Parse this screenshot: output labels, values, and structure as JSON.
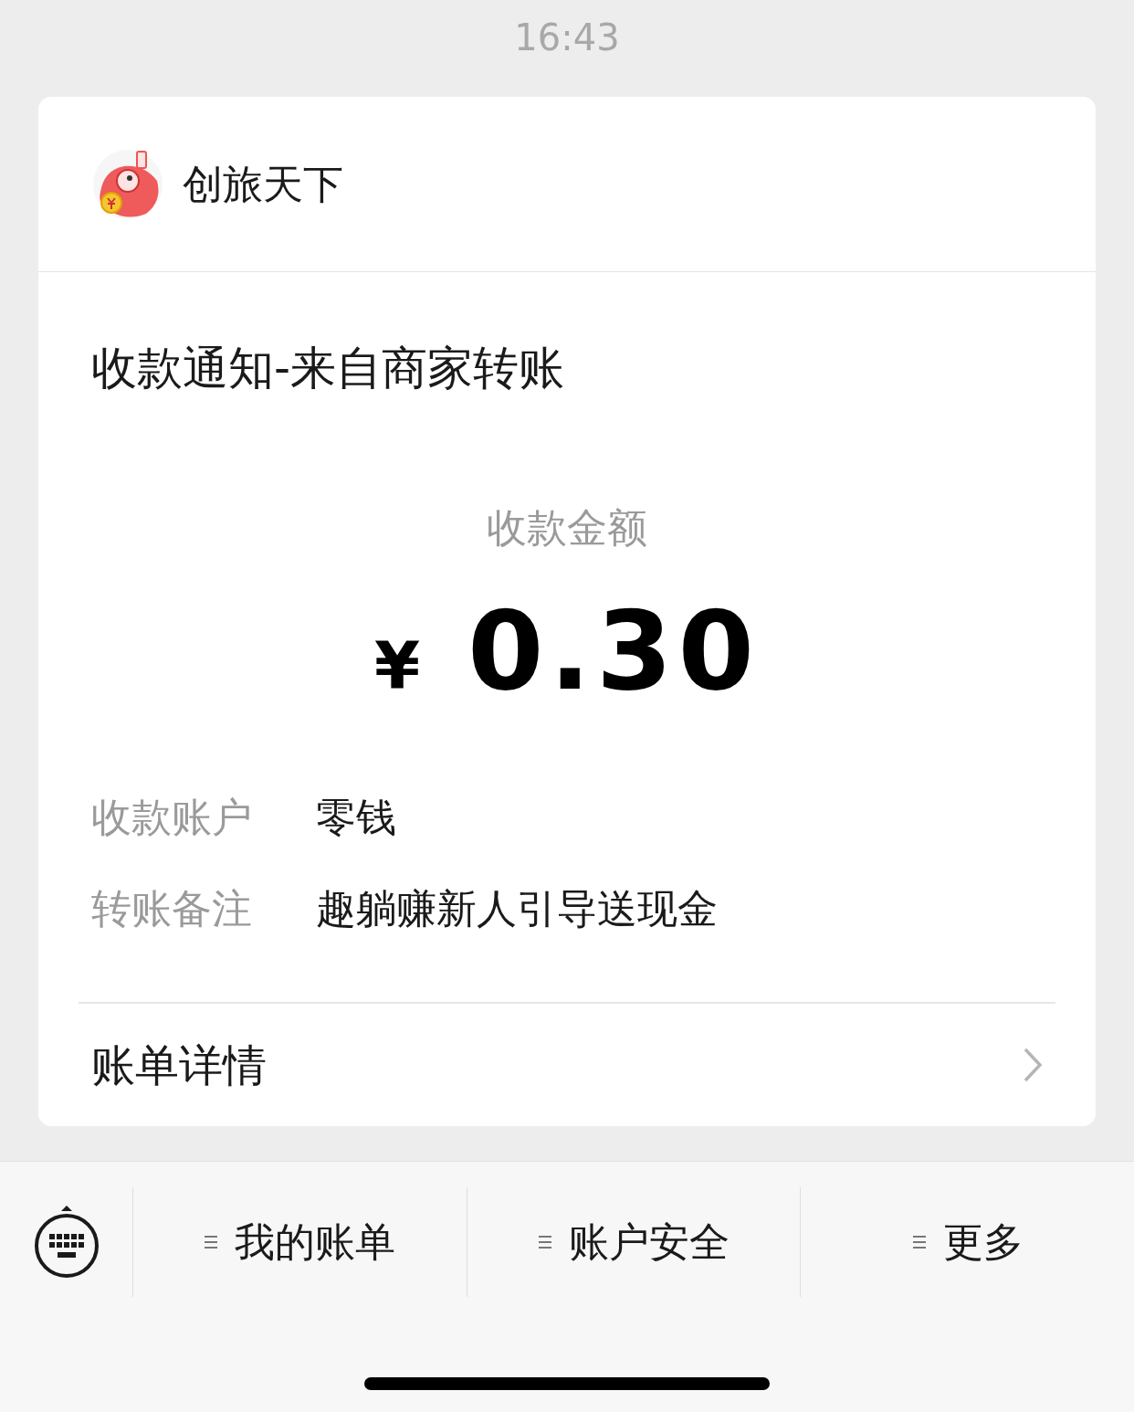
{
  "status_bar": {
    "time": "16:43"
  },
  "card": {
    "merchant": {
      "name": "创旅天下"
    },
    "title": "收款通知-来自商家转账",
    "amount_label": "收款金额",
    "currency": "¥",
    "amount": "0.30",
    "fields": [
      {
        "label": "收款账户",
        "value": "零钱"
      },
      {
        "label": "转账备注",
        "value": "趣躺赚新人引导送现金"
      }
    ],
    "link": {
      "label": "账单详情"
    }
  },
  "menu_bar": {
    "items": [
      {
        "label": "我的账单"
      },
      {
        "label": "账户安全"
      },
      {
        "label": "更多"
      }
    ]
  }
}
